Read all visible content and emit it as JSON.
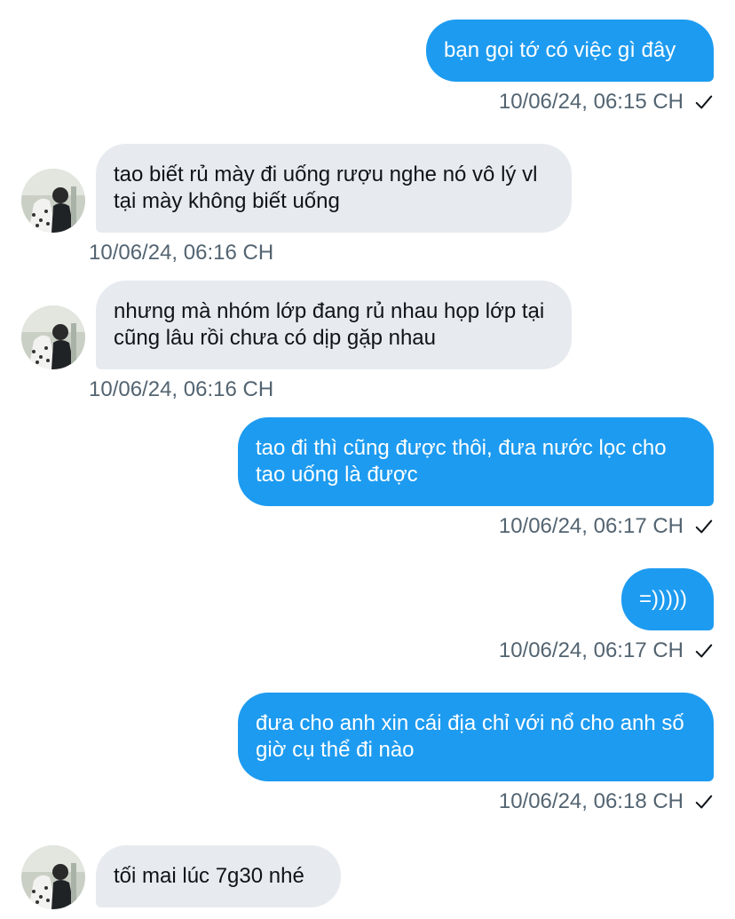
{
  "messages": [
    {
      "direction": "out",
      "text": "bạn gọi tớ có việc gì đây",
      "time": "10/06/24, 06:15 CH",
      "status_icon": "check-icon"
    },
    {
      "direction": "in",
      "text": "tao biết rủ mày đi uống rượu nghe nó vô lý vl tại mày không biết uống",
      "time": "10/06/24, 06:16 CH",
      "avatar_icon": "avatar-image"
    },
    {
      "direction": "in",
      "text": "nhưng mà nhóm lớp đang rủ nhau họp lớp tại cũng lâu rồi chưa có dịp gặp nhau",
      "time": "10/06/24, 06:16 CH",
      "avatar_icon": "avatar-image"
    },
    {
      "direction": "out",
      "text": "tao đi thì cũng được thôi, đưa nước lọc cho tao uống là được",
      "time": "10/06/24, 06:17 CH",
      "status_icon": "check-icon"
    },
    {
      "direction": "out",
      "text": "=)))))",
      "time": "10/06/24, 06:17 CH",
      "status_icon": "check-icon"
    },
    {
      "direction": "out",
      "text": "đưa cho anh xin cái địa chỉ với nổ cho anh số giờ cụ thể đi nào",
      "time": "10/06/24, 06:18 CH",
      "status_icon": "check-icon"
    },
    {
      "direction": "in",
      "text": "tối mai lúc 7g30 nhé",
      "avatar_icon": "avatar-image"
    }
  ],
  "colors": {
    "outgoing_bubble": "#1d9bf0",
    "incoming_bubble": "#e7ebef",
    "timestamp": "#536471",
    "text_dark": "#0f1419"
  }
}
